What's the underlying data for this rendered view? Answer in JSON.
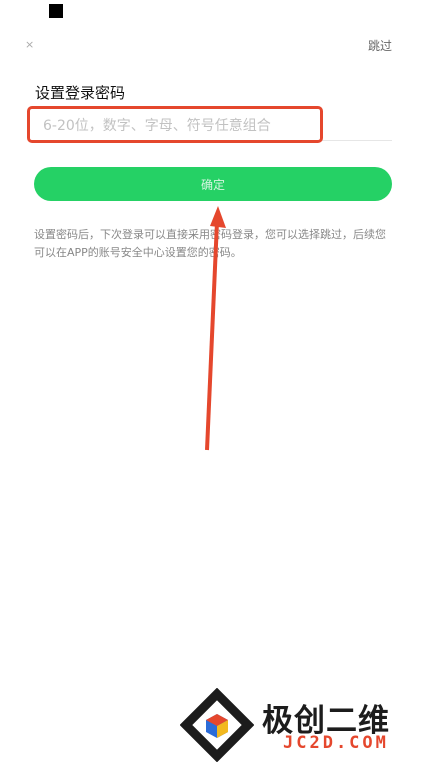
{
  "topbar": {
    "close_icon": "×",
    "skip_label": "跳过"
  },
  "form": {
    "title": "设置登录密码",
    "password_placeholder": "6-20位，数字、字母、符号任意组合",
    "confirm_label": "确定",
    "hint": "设置密码后，下次登录可以直接采用密码登录，您可以选择跳过，后续您可以在APP的账号安全中心设置您的密码。"
  },
  "watermark": {
    "main": "极创二维",
    "sub": "JC2D.COM"
  },
  "colors": {
    "accent": "#25d165",
    "highlight": "#e5472d"
  }
}
